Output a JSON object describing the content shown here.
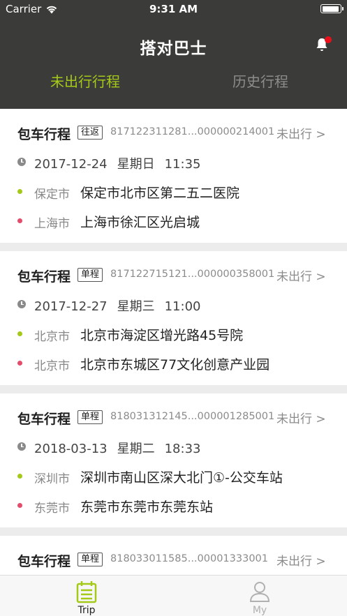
{
  "status_bar": {
    "carrier": "Carrier",
    "time": "9:31 AM"
  },
  "app": {
    "title": "搭对巴士"
  },
  "tabs": [
    {
      "label": "未出行行程",
      "active": true
    },
    {
      "label": "历史行程",
      "active": false
    }
  ],
  "trips": [
    {
      "type": "包车行程",
      "tag": "往返",
      "order_no": "817122311281...000000214001",
      "status": "未出行 >",
      "date": "2017-12-24",
      "weekday": "星期日",
      "time": "11:35",
      "from_city": "保定市",
      "from_addr": "保定市北市区第二五二医院",
      "to_city": "上海市",
      "to_addr": "上海市徐汇区光启城"
    },
    {
      "type": "包车行程",
      "tag": "单程",
      "order_no": "817122715121...000000358001",
      "status": "未出行 >",
      "date": "2017-12-27",
      "weekday": "星期三",
      "time": "11:00",
      "from_city": "北京市",
      "from_addr": "北京市海淀区增光路45号院",
      "to_city": "北京市",
      "to_addr": "北京市东城区77文化创意产业园"
    },
    {
      "type": "包车行程",
      "tag": "单程",
      "order_no": "818031312145...000001285001",
      "status": "未出行 >",
      "date": "2018-03-13",
      "weekday": "星期二",
      "time": "18:33",
      "from_city": "深圳市",
      "from_addr": "深圳市南山区深大北门①-公交车站",
      "to_city": "东莞市",
      "to_addr": "东莞市东莞市东莞东站"
    },
    {
      "type": "包车行程",
      "tag": "单程",
      "order_no": "818033011585...00001333001",
      "status": "未出行 >"
    }
  ],
  "tabbar": [
    {
      "label": "Trip",
      "icon": "calendar-icon",
      "active": true
    },
    {
      "label": "My",
      "icon": "person-icon",
      "active": false
    }
  ],
  "colors": {
    "accent": "#a5c918",
    "header_bg": "#3b3b39",
    "dest_dot": "#e34c6b",
    "badge": "#e8111b"
  }
}
